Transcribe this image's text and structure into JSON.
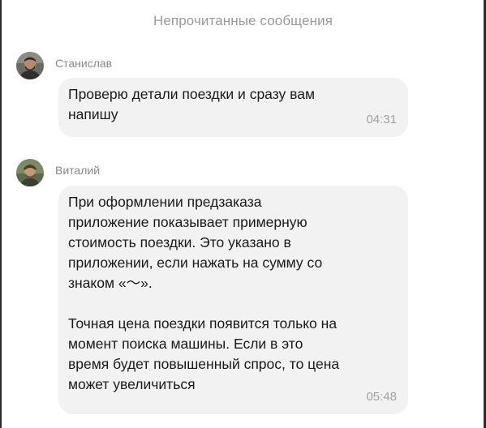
{
  "header": {
    "title": "Непрочитанные сообщения"
  },
  "messages": [
    {
      "sender": "Станислав",
      "text": "Проверю детали поездки и сразу вам\nнапишу",
      "time": "04:31"
    },
    {
      "sender": "Виталий",
      "text": "При оформлении предзаказа\nприложение показывает примерную\nстоимость поездки. Это указано в\nприложении, если нажать на сумму со\nзнаком «〜».\n\nТочная цена поездки появится только на\nмомент поиска машины. Если в это\nвремя будет повышенный спрос, то цена\nможет увеличиться",
      "time": "05:48"
    }
  ],
  "colors": {
    "bubble_bg": "#f2f2f3",
    "meta_text": "#8a8a8a",
    "body_text": "#1a1a1a"
  }
}
